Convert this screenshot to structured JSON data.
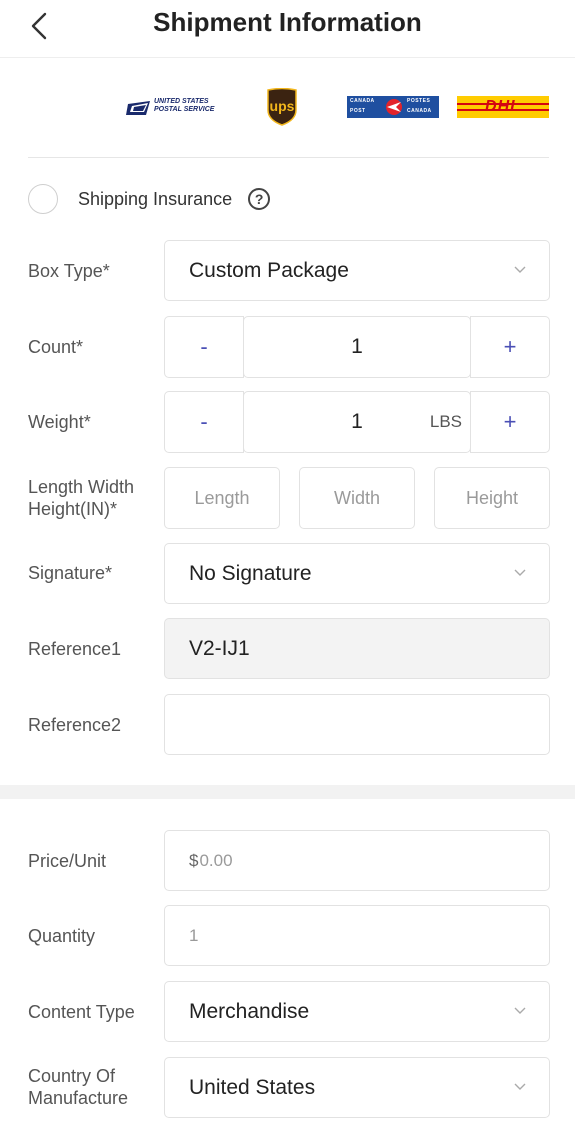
{
  "header": {
    "title": "Shipment Information",
    "back_icon": "chevron-left-icon"
  },
  "carriers": {
    "usps": {
      "line1": "UNITED STATES",
      "line2": "POSTAL SERVICE"
    },
    "ups": {
      "text": "ups"
    },
    "canada_post": {
      "line1a": "CANADA",
      "line1b": "POSTES",
      "line2a": "POST",
      "line2b": "CANADA"
    },
    "dhl": {
      "text": "DHL",
      "color": "#d40511",
      "bg": "#ffcc00"
    }
  },
  "insurance": {
    "label": "Shipping Insurance",
    "help": "?"
  },
  "form": {
    "box_type": {
      "label": "Box Type*",
      "value": "Custom Package"
    },
    "count": {
      "label": "Count*",
      "minus": "-",
      "value": "1",
      "plus": "+"
    },
    "weight": {
      "label": "Weight*",
      "minus": "-",
      "value": "1",
      "unit": "LBS",
      "plus": "+"
    },
    "dimensions": {
      "label_line1": "Length Width",
      "label_line2": "Height(IN)*",
      "length": "Length",
      "width": "Width",
      "height": "Height"
    },
    "signature": {
      "label": "Signature*",
      "value": "No Signature"
    },
    "reference1": {
      "label": "Reference1",
      "value": "V2-IJ1"
    },
    "reference2": {
      "label": "Reference2",
      "value": ""
    }
  },
  "customs": {
    "price": {
      "label": "Price/Unit",
      "prefix": "$",
      "placeholder": "0.00"
    },
    "quantity": {
      "label": "Quantity",
      "placeholder": "1"
    },
    "content_type": {
      "label": "Content Type",
      "value": "Merchandise"
    },
    "country": {
      "label_line1": "Country Of",
      "label_line2": "Manufacture",
      "value": "United States"
    }
  },
  "colors": {
    "accent": "#4a4fb5",
    "border": "#e2e2e2"
  }
}
